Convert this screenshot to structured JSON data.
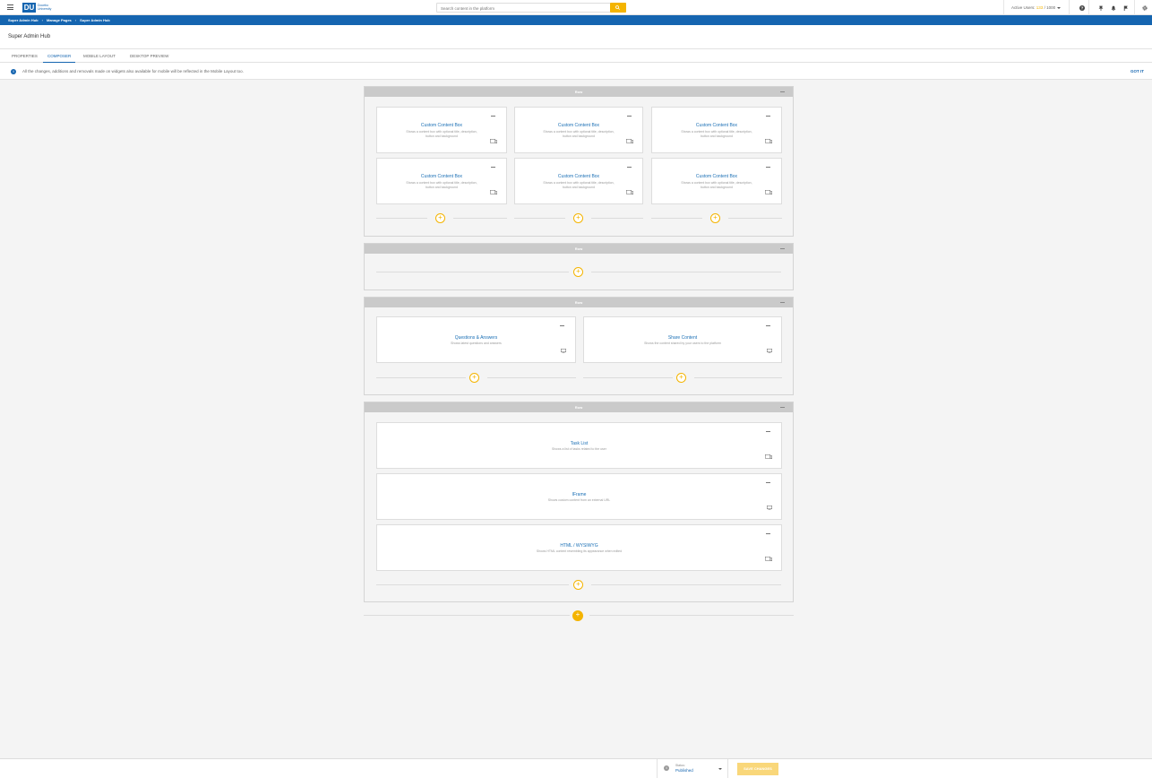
{
  "topbar": {
    "search_placeholder": "Search content in the platform",
    "logo_letters": "DU",
    "logo_text": "Docebo University",
    "active_users_label": "Active Users:",
    "active_users_count": "133",
    "active_users_total": "/ 1000",
    "icons": [
      "help-icon",
      "pin-icon",
      "bell-icon",
      "flag-icon",
      "gear-icon"
    ]
  },
  "breadcrumb": [
    "Super Admin Hub",
    "Manage Pages",
    "Super Admin Hub"
  ],
  "page": {
    "title": "Super Admin Hub"
  },
  "tabs": [
    "PROPERTIES",
    "COMPOSER",
    "MOBILE LAYOUT",
    "DESKTOP PREVIEW"
  ],
  "info": {
    "message": "All the changes, additions and removals made on widgets also available for mobile will be reflected in the Mobile Layout too.",
    "gotit": "GOT IT"
  },
  "composer": {
    "row_label": "Row",
    "widgets": {
      "ccb": {
        "title": "Custom Content Box",
        "desc": "Shows a content box with optional title, description, button and background"
      },
      "qa": {
        "title": "Questions & Answers",
        "desc": "Shows latest questions and answers"
      },
      "share": {
        "title": "Share Content",
        "desc": "Shows the content shared by your users to the platform"
      },
      "task": {
        "title": "Task List",
        "desc": "Shows a list of tasks related to the user"
      },
      "iframe": {
        "title": "IFrame",
        "desc": "Shows custom content from an external URL"
      },
      "html": {
        "title": "HTML / WYSIWYG",
        "desc": "Shows HTML content resembling its appearance when edited"
      }
    }
  },
  "footer": {
    "status_label": "Status:",
    "status_value": "Published",
    "save_label": "SAVE CHANGES"
  },
  "colors": {
    "primary": "#1565b0",
    "accent": "#f4b400"
  }
}
